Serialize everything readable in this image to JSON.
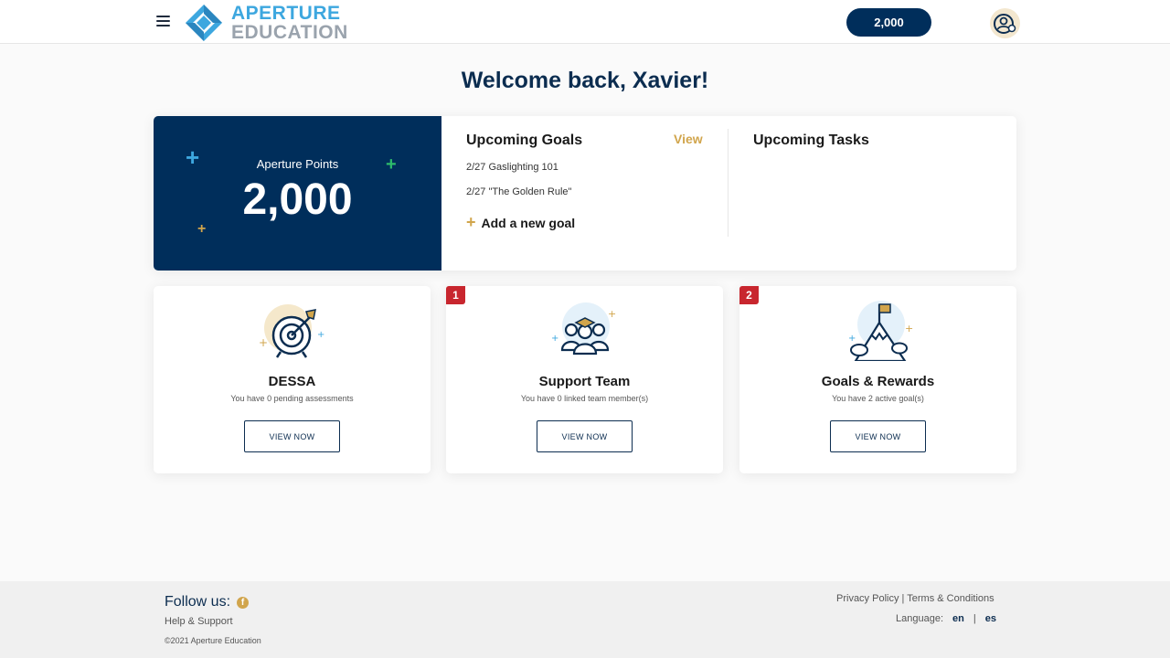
{
  "header": {
    "brand_line1": "APERTURE",
    "brand_line2": "EDUCATION",
    "points_pill": "2,000"
  },
  "welcome_title": "Welcome back, Xavier!",
  "points_panel": {
    "label": "Aperture Points",
    "value": "2,000"
  },
  "goals": {
    "title": "Upcoming Goals",
    "view_label": "View",
    "items": [
      "2/27 Gaslighting 101",
      "2/27 \"The Golden Rule\""
    ],
    "add_label": "Add a new goal"
  },
  "tasks": {
    "title": "Upcoming Tasks"
  },
  "cards": [
    {
      "title": "DESSA",
      "subtitle": "You have 0 pending assessments",
      "button": "VIEW NOW",
      "badge": "",
      "icon": "target-icon"
    },
    {
      "title": "Support Team",
      "subtitle": "You have 0 linked team member(s)",
      "button": "VIEW NOW",
      "badge": "1",
      "icon": "team-icon"
    },
    {
      "title": "Goals & Rewards",
      "subtitle": "You have 2 active goal(s)",
      "button": "VIEW NOW",
      "badge": "2",
      "icon": "mountain-flag-icon"
    }
  ],
  "footer": {
    "follow_label": "Follow us:",
    "help_label": "Help & Support",
    "copyright": "©2021 Aperture Education",
    "privacy": "Privacy Policy",
    "divider": " | ",
    "terms": "Terms & Conditions",
    "language_label": "Language:",
    "lang_en": "en",
    "lang_es": "es"
  },
  "colors": {
    "navy": "#002e5b",
    "accent_blue": "#3da7df",
    "gold": "#d1a54c",
    "badge_red": "#c8262e"
  }
}
